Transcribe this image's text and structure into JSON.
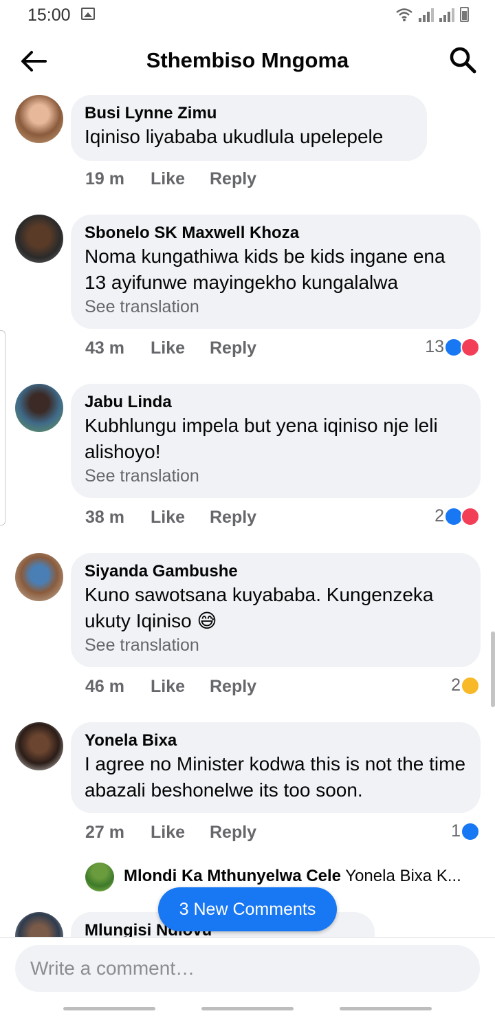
{
  "status_bar": {
    "time": "15:00"
  },
  "header": {
    "title": "Sthembiso Mngoma"
  },
  "comments": [
    {
      "name": "Busi Lynne Zimu",
      "text": "Iqiniso liyababa ukudlula upelepele",
      "see_translation": "",
      "time": "19 m",
      "like": "Like",
      "reply": "Reply",
      "reaction_count": "",
      "reactions": []
    },
    {
      "name": "Sbonelo SK Maxwell Khoza",
      "text": "Noma kungathiwa kids be kids ingane ena 13 ayifunwe mayingekho kungalalwa",
      "see_translation": "See translation",
      "time": "43 m",
      "like": "Like",
      "reply": "Reply",
      "reaction_count": "13",
      "reactions": [
        "like-icon",
        "love-icon"
      ]
    },
    {
      "name": "Jabu Linda",
      "text": "Kubhlungu impela but yena iqiniso nje leli alishoyo!",
      "see_translation": "See translation",
      "time": "38 m",
      "like": "Like",
      "reply": "Reply",
      "reaction_count": "2",
      "reactions": [
        "like-icon",
        "love-icon"
      ]
    },
    {
      "name": "Siyanda Gambushe",
      "text": "Kuno sawotsana kuyababa. Kungenzeka ukuty Iqiniso 😅",
      "see_translation": "See translation",
      "time": "46 m",
      "like": "Like",
      "reply": "Reply",
      "reaction_count": "2",
      "reactions": [
        "haha-icon"
      ]
    },
    {
      "name": "Yonela Bixa",
      "text": "I agree no Minister kodwa this is not the time abazali beshonelwe its too soon.",
      "see_translation": "",
      "time": "27 m",
      "like": "Like",
      "reply": "Reply",
      "reaction_count": "1",
      "reactions": [
        "like-icon"
      ]
    }
  ],
  "reply_preview": {
    "name": "Mlondi Ka Mthunyelwa Cele",
    "text": "Yonela Bixa  K..."
  },
  "partial_comment": {
    "name": "Mlungisi Ndlovu"
  },
  "new_comments_label": "3 New Comments",
  "composer": {
    "placeholder": "Write a comment…"
  },
  "colors": {
    "accent": "#1877f2",
    "bubble": "#f0f2f5",
    "secondary_text": "#65676b",
    "love": "#f33e58",
    "haha": "#f7b928"
  }
}
